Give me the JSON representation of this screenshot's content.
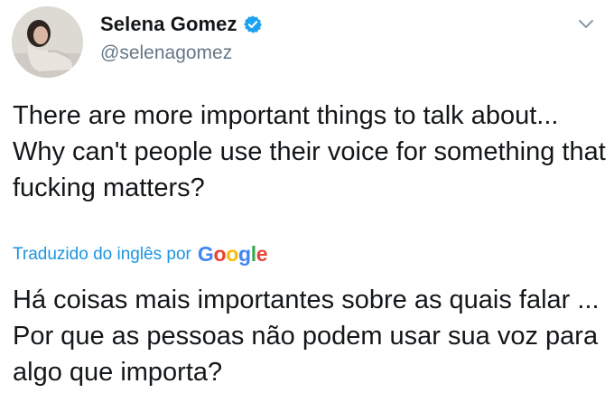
{
  "author": {
    "display_name": "Selena Gomez",
    "handle": "@selenagomez",
    "verified": true
  },
  "tweet": {
    "text": "There are more important things to talk about... Why can't people use their voice for something that fucking matters?"
  },
  "translation": {
    "credit_label": "Traduzido do inglês por",
    "provider_letters": [
      "G",
      "o",
      "o",
      "g",
      "l",
      "e"
    ],
    "text": "Há coisas mais importantes sobre as quais falar ... Por que as pessoas não podem usar sua voz para algo que importa?"
  },
  "icons": {
    "verified": "verified-badge-icon",
    "menu": "chevron-down-icon",
    "avatar": "avatar"
  },
  "colors": {
    "text": "#14171a",
    "secondary": "#657786",
    "accent": "#1b95e0",
    "verified": "#1da1f2"
  }
}
